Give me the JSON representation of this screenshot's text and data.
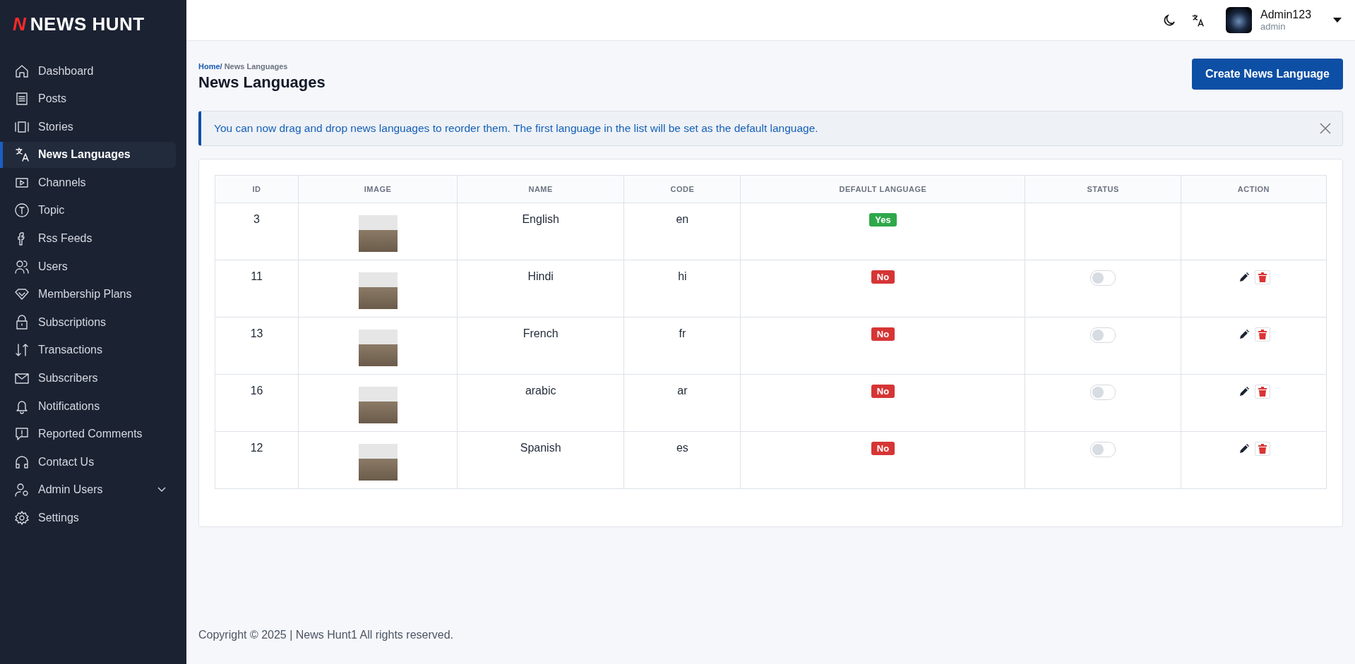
{
  "brand": {
    "mark": "N",
    "name": "NEWS HUNT"
  },
  "sidebar": {
    "items": [
      {
        "label": "Dashboard",
        "selected": false
      },
      {
        "label": "Posts",
        "selected": false
      },
      {
        "label": "Stories",
        "selected": false
      },
      {
        "label": "News Languages",
        "selected": true
      },
      {
        "label": "Channels",
        "selected": false
      },
      {
        "label": "Topic",
        "selected": false
      },
      {
        "label": "Rss Feeds",
        "selected": false
      },
      {
        "label": "Users",
        "selected": false
      },
      {
        "label": "Membership Plans",
        "selected": false
      },
      {
        "label": "Subscriptions",
        "selected": false
      },
      {
        "label": "Transactions",
        "selected": false
      },
      {
        "label": "Subscribers",
        "selected": false
      },
      {
        "label": "Notifications",
        "selected": false
      },
      {
        "label": "Reported Comments",
        "selected": false
      },
      {
        "label": "Contact Us",
        "selected": false
      },
      {
        "label": "Admin Users",
        "selected": false,
        "expanded": false
      },
      {
        "label": "Settings",
        "selected": false
      }
    ]
  },
  "header": {
    "user": {
      "name": "Admin123",
      "role": "admin"
    }
  },
  "breadcrumb": [
    {
      "label": "Home/",
      "link": true
    },
    {
      "label": "News Languages",
      "link": false
    }
  ],
  "page_title": "News Languages",
  "create_button": "Create News Language",
  "alert": "You can now drag and drop news languages to reorder them. The first language in the list will be set as the default language.",
  "table": {
    "columns": [
      "ID",
      "IMAGE",
      "NAME",
      "CODE",
      "DEFAULT LANGUAGE",
      "STATUS",
      "ACTION"
    ],
    "rows": [
      {
        "id": "3",
        "name": "English",
        "code": "en",
        "default_language": "Yes",
        "is_default": true,
        "actions": false
      },
      {
        "id": "11",
        "name": "Hindi",
        "code": "hi",
        "default_language": "No",
        "is_default": false,
        "status_on": false,
        "actions": true
      },
      {
        "id": "13",
        "name": "French",
        "code": "fr",
        "default_language": "No",
        "is_default": false,
        "status_on": false,
        "actions": true
      },
      {
        "id": "16",
        "name": "arabic",
        "code": "ar",
        "default_language": "No",
        "is_default": false,
        "status_on": false,
        "actions": true
      },
      {
        "id": "12",
        "name": "Spanish",
        "code": "es",
        "default_language": "No",
        "is_default": false,
        "status_on": false,
        "actions": true
      }
    ]
  },
  "footer": "Copyright © 2025 | News Hunt1 All rights reserved."
}
